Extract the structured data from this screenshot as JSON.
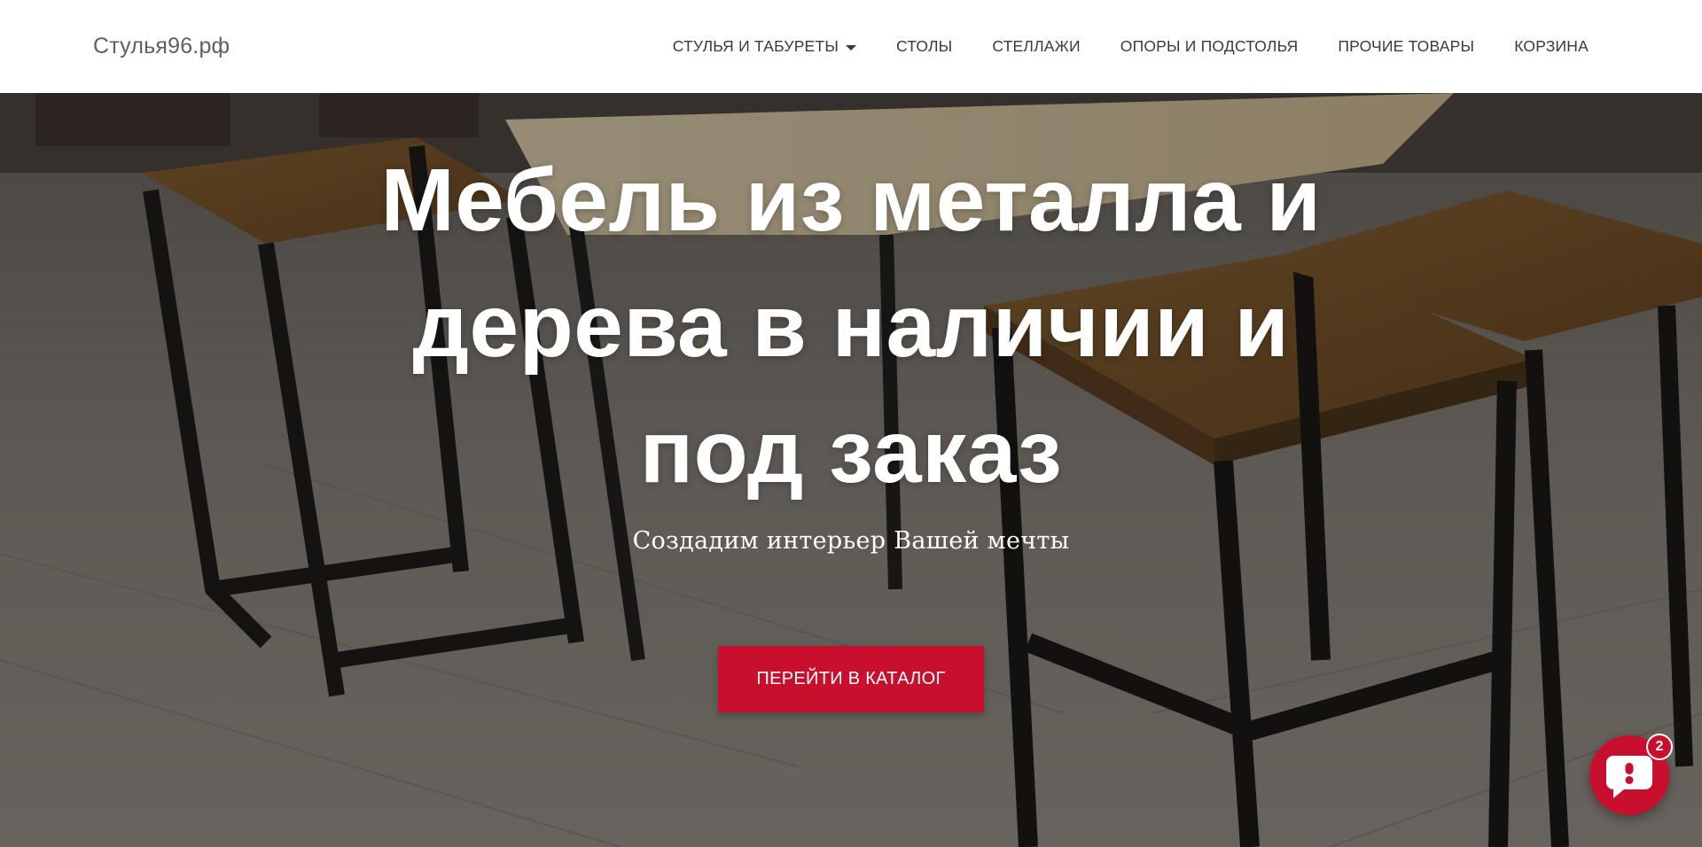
{
  "header": {
    "logo": "Стулья96.рф",
    "nav": [
      {
        "label": "СТУЛЬЯ И ТАБУРЕТЫ",
        "has_dropdown": true
      },
      {
        "label": "СТОЛЫ"
      },
      {
        "label": "СТЕЛЛАЖИ"
      },
      {
        "label": "ОПОРЫ И ПОДСТОЛЬЯ"
      },
      {
        "label": "ПРОЧИЕ ТОВАРЫ"
      },
      {
        "label": "КОРЗИНА"
      }
    ]
  },
  "hero": {
    "title_lines": [
      "Мебель из металла и",
      "дерева в наличии и",
      "под заказ"
    ],
    "subtitle": "Создадим интерьер Вашей мечты",
    "cta_label": "ПЕРЕЙТИ В КАТАЛОГ",
    "background_icon": "furniture-photo"
  },
  "chat": {
    "icon": "chat-bubble-icon",
    "badge_count": "2"
  },
  "colors": {
    "accent": "#c8102e",
    "header_bg": "#ffffff",
    "nav_text": "#3a3a3a",
    "logo_text": "#5f5f5f",
    "hero_text": "#ffffff"
  }
}
